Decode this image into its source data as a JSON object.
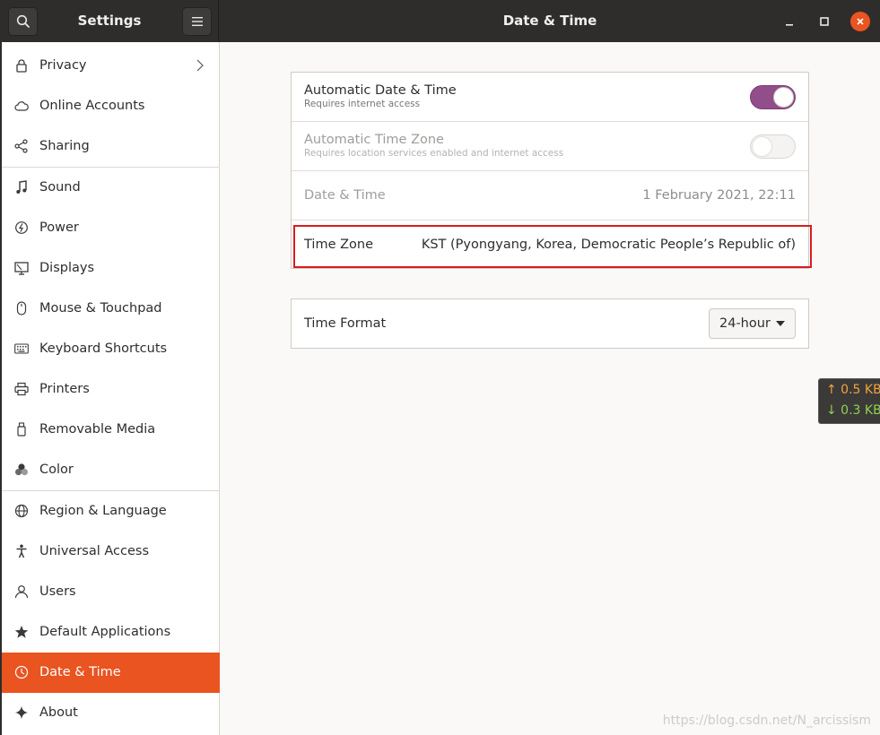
{
  "header": {
    "sidebar_title": "Settings",
    "main_title": "Date & Time"
  },
  "sidebar": {
    "items": [
      {
        "label": "Privacy",
        "icon": "lock-icon"
      },
      {
        "label": "Online Accounts",
        "icon": "cloud-icon"
      },
      {
        "label": "Sharing",
        "icon": "share-icon"
      },
      {
        "label": "Sound",
        "icon": "music-note-icon"
      },
      {
        "label": "Power",
        "icon": "power-icon"
      },
      {
        "label": "Displays",
        "icon": "display-icon"
      },
      {
        "label": "Mouse & Touchpad",
        "icon": "mouse-icon"
      },
      {
        "label": "Keyboard Shortcuts",
        "icon": "keyboard-icon"
      },
      {
        "label": "Printers",
        "icon": "printer-icon"
      },
      {
        "label": "Removable Media",
        "icon": "usb-drive-icon"
      },
      {
        "label": "Color",
        "icon": "color-circles-icon"
      },
      {
        "label": "Region & Language",
        "icon": "globe-icon"
      },
      {
        "label": "Universal Access",
        "icon": "accessibility-icon"
      },
      {
        "label": "Users",
        "icon": "user-icon"
      },
      {
        "label": "Default Applications",
        "icon": "star-icon"
      },
      {
        "label": "Date & Time",
        "icon": "clock-icon",
        "active": true
      },
      {
        "label": "About",
        "icon": "sparkle-icon"
      }
    ]
  },
  "datetime": {
    "auto_datetime": {
      "title": "Automatic Date & Time",
      "subtitle": "Requires internet access",
      "enabled": true
    },
    "auto_timezone": {
      "title": "Automatic Time Zone",
      "subtitle": "Requires location services enabled and internet access",
      "enabled": false
    },
    "date_time": {
      "title": "Date & Time",
      "value": "1 February 2021, 22:11"
    },
    "time_zone": {
      "title": "Time Zone",
      "value": "KST (Pyongyang, Korea, Democratic People’s Republic of)"
    },
    "time_format": {
      "title": "Time Format",
      "value": "24-hour"
    }
  },
  "net_widget": {
    "up": "↑ 0.5 KB",
    "down": "↓ 0.3 KB"
  },
  "watermark": "https://blog.csdn.net/N_arcissism",
  "colors": {
    "accent": "#e95420",
    "toggle_on": "#924d8b",
    "header_bg": "#2e2d2c",
    "highlight": "#d81e1e"
  }
}
